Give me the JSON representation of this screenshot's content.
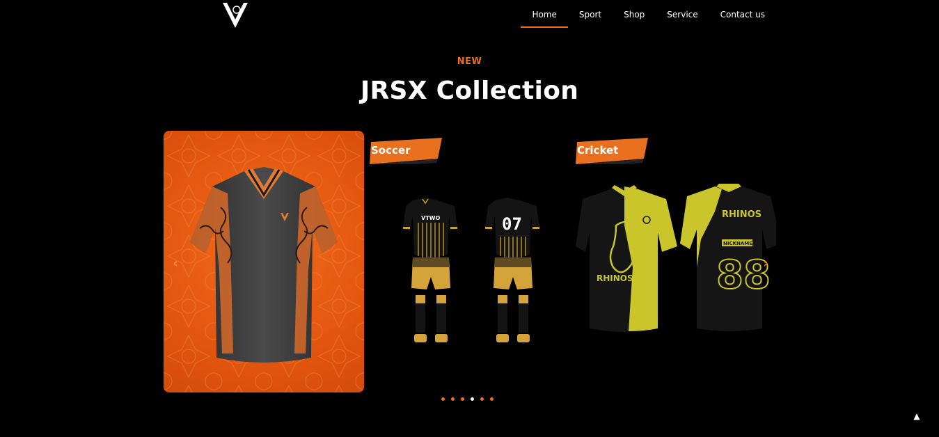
{
  "nav": {
    "items": [
      {
        "label": "Home",
        "active": true
      },
      {
        "label": "Sport"
      },
      {
        "label": "Shop"
      },
      {
        "label": "Service"
      },
      {
        "label": "Contact us"
      }
    ]
  },
  "hero": {
    "eyebrow": "NEW",
    "title": "JRSX Collection"
  },
  "carousel": {
    "slides": [
      {
        "tag": "",
        "theme": "orange-pattern-jersey"
      },
      {
        "tag": "Soccer",
        "jersey_front": "VTWO",
        "jersey_back_number": "07"
      },
      {
        "tag": "Cricket",
        "team": "RHINOS",
        "nickname": "NICKNAME",
        "number": "88"
      }
    ],
    "dots": 6,
    "active_dot": 3
  },
  "colors": {
    "accent": "#e8701e",
    "background": "#000000",
    "cricket_yellow": "#c9c52a"
  }
}
